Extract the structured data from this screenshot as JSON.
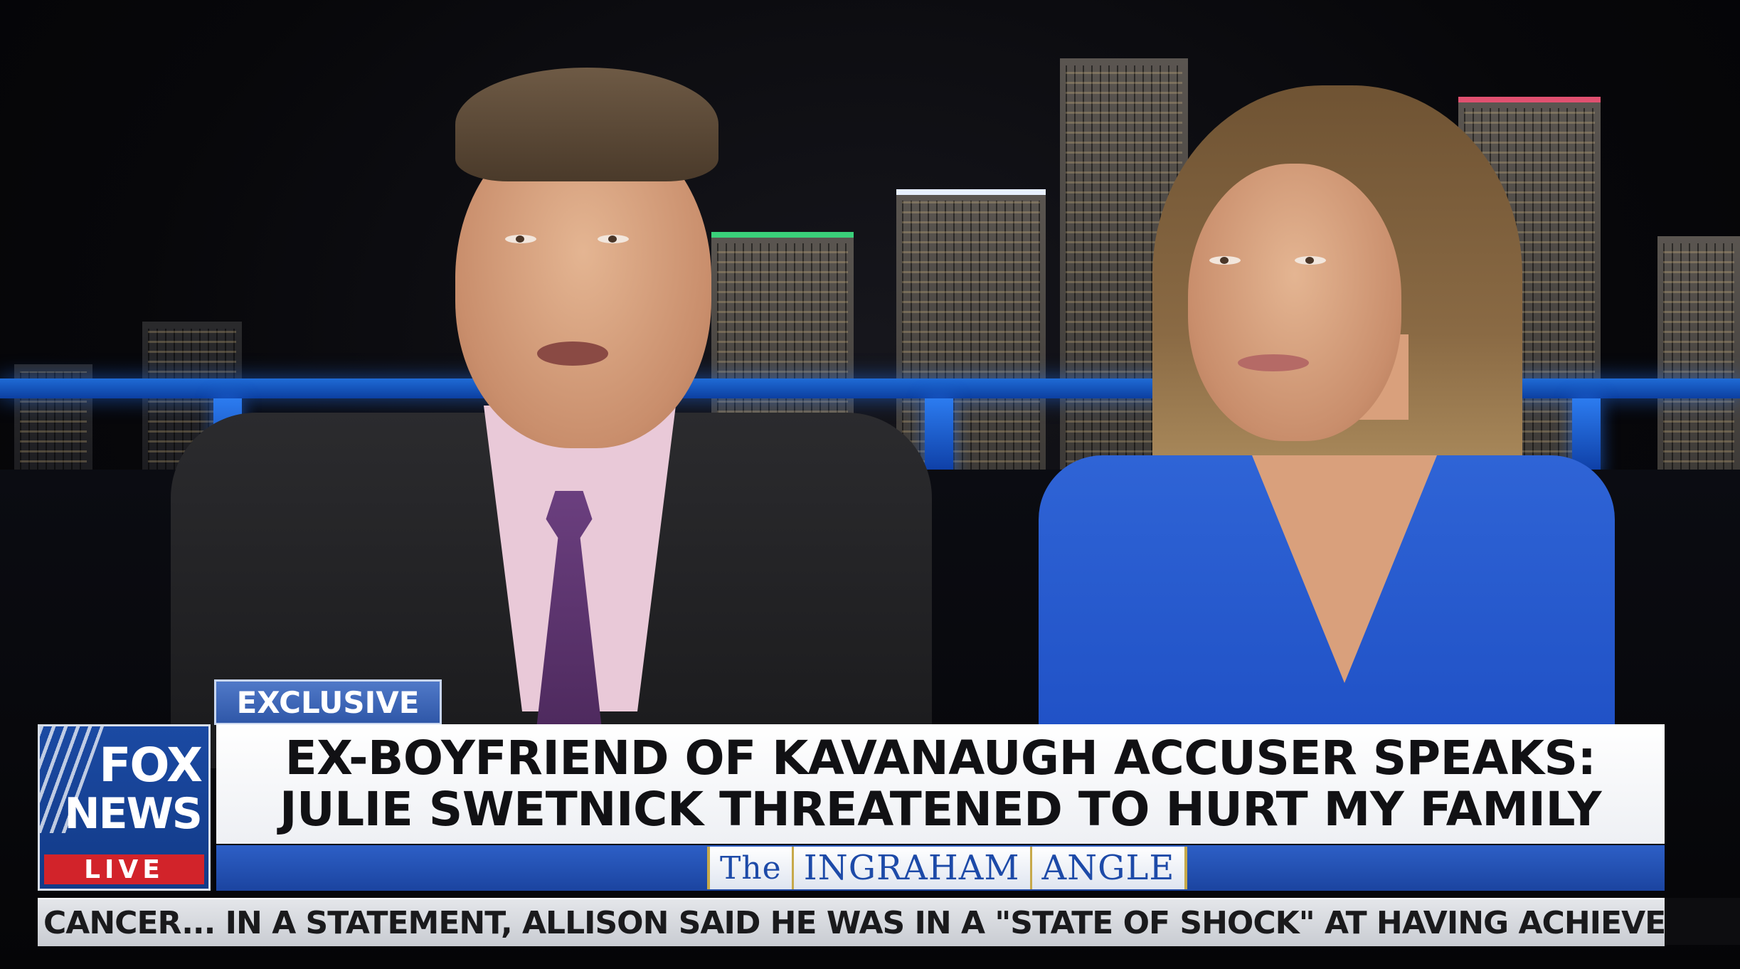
{
  "lower_third": {
    "tag": "EXCLUSIVE",
    "headline_line1": "EX-BOYFRIEND OF KAVANAUGH ACCUSER SPEAKS:",
    "headline_line2": "JULIE SWETNICK THREATENED TO HURT MY FAMILY",
    "show_name": {
      "word1": "The",
      "word2": "INGRAHAM",
      "word3": "ANGLE"
    }
  },
  "logo": {
    "line1": "FOX",
    "line2": "NEWS",
    "badge": "LIVE"
  },
  "ticker": {
    "text": "CANCER...    IN A STATEMENT, ALLISON SAID HE WAS IN A \"STATE OF SHOCK\" AT HAVING ACHIEVED \"EV"
  },
  "colors": {
    "network_blue": "#1b4aa3",
    "live_red": "#d2232a",
    "headline_bg": "#ffffff",
    "show_bar_blue": "#2d5fc6",
    "show_accent_gold": "#c7a94a"
  }
}
